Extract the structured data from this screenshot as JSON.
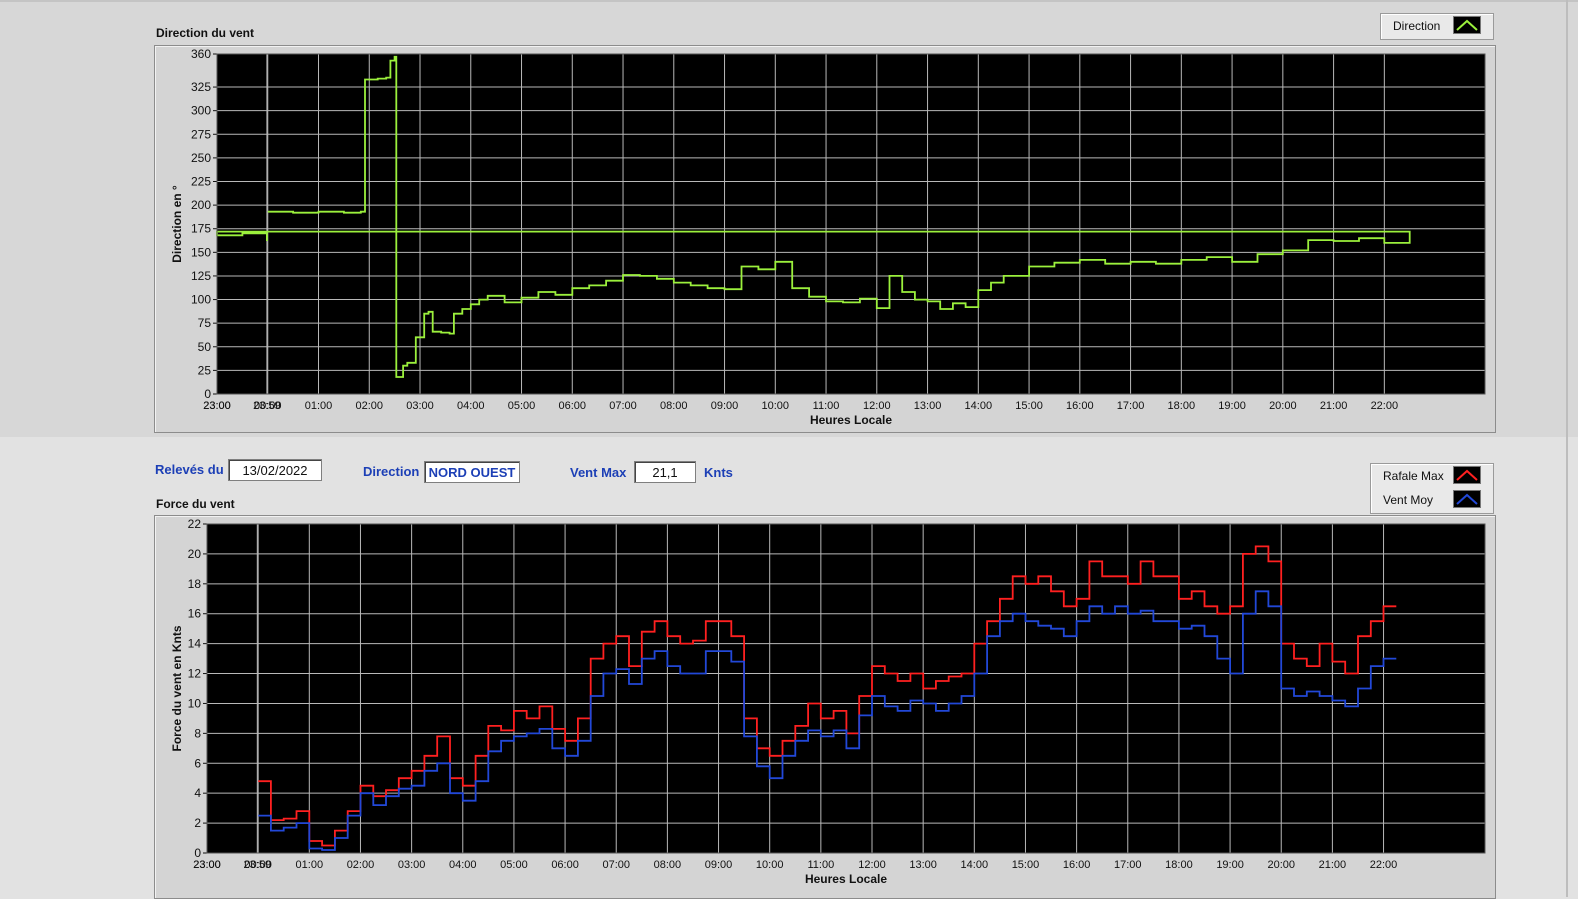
{
  "top_chart": {
    "title": "Direction du vent",
    "legend": [
      {
        "label": "Direction",
        "color": "#9bf03c"
      }
    ],
    "chart_data": {
      "type": "line",
      "title": "Direction du vent",
      "xlabel": "Heures Locale",
      "ylabel": "Direction en °",
      "x_tick_labels": [
        "23:00",
        "00:00",
        "01:00",
        "02:00",
        "03:00",
        "04:00",
        "05:00",
        "06:00",
        "07:00",
        "08:00",
        "09:00",
        "10:00",
        "11:00",
        "12:00",
        "13:00",
        "14:00",
        "15:00",
        "16:00",
        "17:00",
        "18:00",
        "19:00",
        "20:00",
        "21:00",
        "22:00",
        "23:00",
        "23:59"
      ],
      "y_tick_labels": [
        "0",
        "25",
        "50",
        "75",
        "100",
        "125",
        "150",
        "175",
        "200",
        "225",
        "250",
        "275",
        "300",
        "325",
        "360"
      ],
      "ylim": [
        0,
        360
      ],
      "grid": true,
      "legend_position": "top-right",
      "series": [
        {
          "name": "Direction",
          "color": "#9bf03c",
          "x": [
            "00:00",
            "00:30",
            "01:00",
            "01:30",
            "01:50",
            "01:55",
            "02:10",
            "02:20",
            "02:25",
            "02:30",
            "02:32",
            "02:40",
            "02:45",
            "02:55",
            "03:05",
            "03:10",
            "03:15",
            "03:25",
            "03:35",
            "03:40",
            "03:50",
            "04:00",
            "04:10",
            "04:20",
            "04:40",
            "05:00",
            "05:20",
            "05:40",
            "06:00",
            "06:20",
            "06:40",
            "07:00",
            "07:20",
            "07:40",
            "08:00",
            "08:20",
            "08:40",
            "09:00",
            "09:20",
            "09:40",
            "10:00",
            "10:20",
            "10:40",
            "11:00",
            "11:20",
            "11:40",
            "12:00",
            "12:15",
            "12:30",
            "12:45",
            "13:00",
            "13:15",
            "13:30",
            "13:45",
            "14:00",
            "14:15",
            "14:30",
            "15:00",
            "15:30",
            "16:00",
            "16:30",
            "17:00",
            "17:30",
            "18:00",
            "18:30",
            "19:00",
            "19:30",
            "20:00",
            "20:30",
            "21:00",
            "21:30",
            "22:00",
            "22:30",
            "23:00",
            "23:30",
            "23:59"
          ],
          "y": [
            193,
            192,
            193,
            192,
            193,
            333,
            334,
            335,
            353,
            357,
            18,
            30,
            33,
            60,
            85,
            87,
            66,
            65,
            64,
            85,
            90,
            95,
            100,
            104,
            97,
            102,
            108,
            105,
            112,
            115,
            120,
            126,
            125,
            122,
            118,
            115,
            112,
            111,
            135,
            132,
            140,
            112,
            103,
            98,
            97,
            101,
            91,
            125,
            108,
            100,
            98,
            90,
            96,
            92,
            110,
            118,
            125,
            135,
            139,
            142,
            138,
            140,
            138,
            142,
            145,
            140,
            148,
            152,
            163,
            162,
            165,
            160,
            172,
            168,
            170,
            162
          ]
        }
      ]
    }
  },
  "info": {
    "releves_label": "Relevés du",
    "releves_value": "13/02/2022",
    "direction_label": "Direction",
    "direction_value": "NORD OUEST",
    "ventmax_label": "Vent Max",
    "ventmax_value": "21,1",
    "unit": "Knts"
  },
  "bottom_chart": {
    "title": "Force du vent",
    "legend": [
      {
        "label": "Rafale Max",
        "color": "#ff2020"
      },
      {
        "label": "Vent Moy",
        "color": "#2248d8"
      }
    ],
    "chart_data": {
      "type": "line",
      "title": "Force du vent",
      "xlabel": "Heures Locale",
      "ylabel": "Force du vent en Knts",
      "x_tick_labels": [
        "23:00",
        "00:00",
        "01:00",
        "02:00",
        "03:00",
        "04:00",
        "05:00",
        "06:00",
        "07:00",
        "08:00",
        "09:00",
        "10:00",
        "11:00",
        "12:00",
        "13:00",
        "14:00",
        "15:00",
        "16:00",
        "17:00",
        "18:00",
        "19:00",
        "20:00",
        "21:00",
        "22:00",
        "23:00",
        "23:59"
      ],
      "y_tick_labels": [
        "0",
        "2",
        "4",
        "6",
        "8",
        "10",
        "12",
        "14",
        "16",
        "18",
        "20",
        "22"
      ],
      "ylim": [
        0,
        22
      ],
      "grid": true,
      "legend_position": "top-right",
      "x": [
        "00:00",
        "00:15",
        "00:30",
        "00:45",
        "01:00",
        "01:15",
        "01:30",
        "01:45",
        "02:00",
        "02:15",
        "02:30",
        "02:45",
        "03:00",
        "03:15",
        "03:30",
        "03:45",
        "04:00",
        "04:15",
        "04:30",
        "04:45",
        "05:00",
        "05:15",
        "05:30",
        "05:45",
        "06:00",
        "06:15",
        "06:30",
        "06:45",
        "07:00",
        "07:15",
        "07:30",
        "07:45",
        "08:00",
        "08:15",
        "08:30",
        "08:45",
        "09:00",
        "09:15",
        "09:30",
        "09:45",
        "10:00",
        "10:15",
        "10:30",
        "10:45",
        "11:00",
        "11:15",
        "11:30",
        "11:45",
        "12:00",
        "12:15",
        "12:30",
        "12:45",
        "13:00",
        "13:15",
        "13:30",
        "13:45",
        "14:00",
        "14:15",
        "14:30",
        "14:45",
        "15:00",
        "15:15",
        "15:30",
        "15:45",
        "16:00",
        "16:15",
        "16:30",
        "16:45",
        "17:00",
        "17:15",
        "17:30",
        "17:45",
        "18:00",
        "18:15",
        "18:30",
        "18:45",
        "19:00",
        "19:15",
        "19:30",
        "19:45",
        "20:00",
        "20:15",
        "20:30",
        "20:45",
        "21:00",
        "21:15",
        "21:30",
        "21:45",
        "22:00",
        "22:15",
        "22:30",
        "22:45",
        "23:00",
        "23:15",
        "23:30",
        "23:45",
        "23:59"
      ],
      "series": [
        {
          "name": "Rafale Max",
          "color": "#ff2020",
          "values": [
            4.8,
            2.2,
            2.3,
            2.8,
            0.8,
            0.5,
            1.5,
            2.8,
            4.5,
            3.8,
            4.2,
            5.0,
            5.5,
            6.5,
            7.8,
            5.0,
            4.5,
            6.5,
            8.5,
            8.2,
            9.5,
            9.0,
            9.8,
            8.3,
            7.5,
            9.0,
            13.0,
            14.0,
            14.5,
            12.5,
            14.8,
            15.5,
            14.5,
            14.0,
            14.2,
            15.5,
            15.5,
            14.5,
            9.0,
            7.0,
            6.5,
            7.5,
            8.5,
            10.0,
            9.0,
            9.5,
            8.0,
            10.5,
            12.5,
            12.0,
            11.5,
            12.0,
            11.0,
            11.5,
            11.8,
            12.0,
            14.0,
            15.5,
            17.0,
            18.5,
            18.0,
            18.5,
            17.5,
            16.5,
            17.0,
            19.5,
            18.5,
            18.5,
            18.0,
            19.5,
            18.5,
            18.5,
            17.0,
            17.5,
            16.5,
            16.0,
            16.5,
            20.0,
            20.5,
            19.5,
            14.0,
            13.0,
            12.5,
            14.0,
            12.8,
            12.0,
            14.5,
            15.5,
            16.5
          ]
        },
        {
          "name": "Vent Moy",
          "color": "#2248d8",
          "values": [
            2.5,
            1.5,
            1.7,
            2.0,
            0.3,
            0.2,
            1.0,
            2.5,
            4.0,
            3.2,
            3.8,
            4.3,
            4.5,
            5.5,
            6.0,
            4.0,
            3.5,
            4.8,
            6.8,
            7.5,
            7.8,
            8.0,
            8.3,
            7.0,
            6.5,
            7.5,
            10.5,
            12.0,
            12.3,
            11.3,
            13.0,
            13.5,
            12.5,
            12.0,
            12.0,
            13.5,
            13.5,
            12.8,
            7.8,
            5.8,
            5.0,
            6.5,
            7.5,
            8.2,
            7.8,
            8.2,
            7.0,
            9.2,
            10.5,
            9.8,
            9.5,
            10.2,
            10.0,
            9.5,
            10.0,
            10.5,
            12.0,
            14.5,
            15.5,
            16.0,
            15.5,
            15.2,
            15.0,
            14.5,
            15.5,
            16.5,
            16.0,
            16.5,
            16.0,
            16.2,
            15.5,
            15.5,
            15.0,
            15.2,
            14.5,
            13.0,
            12.0,
            16.0,
            17.5,
            16.5,
            11.0,
            10.5,
            10.8,
            10.5,
            10.2,
            9.8,
            11.0,
            12.5,
            13.0
          ]
        }
      ]
    }
  }
}
